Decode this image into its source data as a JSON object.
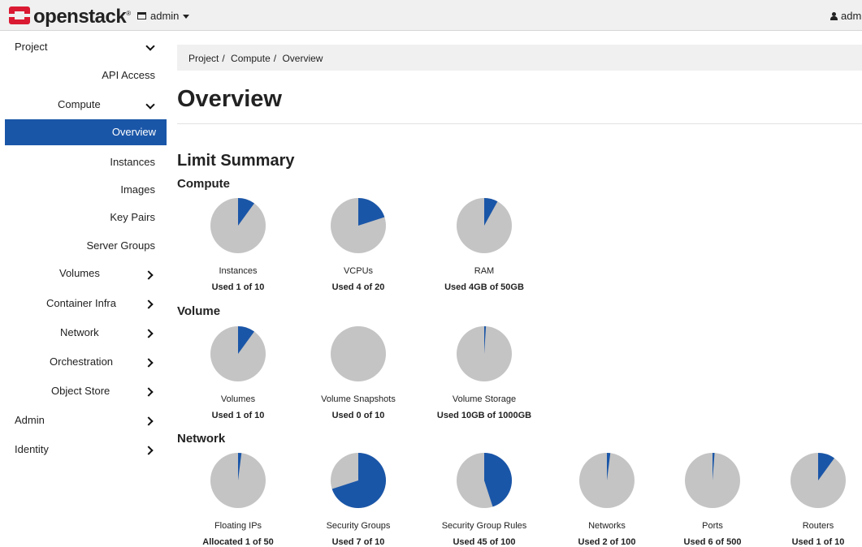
{
  "colors": {
    "accent": "#1a56a8",
    "pie_bg": "#c4c4c4",
    "brand_red": "#da1a32"
  },
  "header": {
    "brand": "openstack",
    "project_label": "admin",
    "user_label": "adm"
  },
  "sidebar": {
    "project": "Project",
    "api_access": "API Access",
    "compute": "Compute",
    "overview": "Overview",
    "instances": "Instances",
    "images": "Images",
    "key_pairs": "Key Pairs",
    "server_groups": "Server Groups",
    "volumes": "Volumes",
    "container_infra": "Container Infra",
    "network": "Network",
    "orchestration": "Orchestration",
    "object_store": "Object Store",
    "admin": "Admin",
    "identity": "Identity"
  },
  "breadcrumb": [
    "Project",
    "Compute",
    "Overview"
  ],
  "page": {
    "title": "Overview",
    "section": "Limit Summary"
  },
  "groups": [
    {
      "name": "Compute",
      "pies": [
        {
          "label": "Instances",
          "used_text": "Used 1 of 10",
          "used": 1,
          "total": 10
        },
        {
          "label": "VCPUs",
          "used_text": "Used 4 of 20",
          "used": 4,
          "total": 20
        },
        {
          "label": "RAM",
          "used_text": "Used 4GB of 50GB",
          "used": 4,
          "total": 50
        }
      ]
    },
    {
      "name": "Volume",
      "pies": [
        {
          "label": "Volumes",
          "used_text": "Used 1 of 10",
          "used": 1,
          "total": 10
        },
        {
          "label": "Volume Snapshots",
          "used_text": "Used 0 of 10",
          "used": 0,
          "total": 10
        },
        {
          "label": "Volume Storage",
          "used_text": "Used 10GB of 1000GB",
          "used": 10,
          "total": 1000
        }
      ]
    },
    {
      "name": "Network",
      "pies": [
        {
          "label": "Floating IPs",
          "used_text": "Allocated 1 of 50",
          "used": 1,
          "total": 50
        },
        {
          "label": "Security Groups",
          "used_text": "Used 7 of 10",
          "used": 7,
          "total": 10
        },
        {
          "label": "Security Group Rules",
          "used_text": "Used 45 of 100",
          "used": 45,
          "total": 100
        },
        {
          "label": "Networks",
          "used_text": "Used 2 of 100",
          "used": 2,
          "total": 100
        },
        {
          "label": "Ports",
          "used_text": "Used 6 of 500",
          "used": 6,
          "total": 500
        },
        {
          "label": "Routers",
          "used_text": "Used 1 of 10",
          "used": 1,
          "total": 10
        }
      ]
    }
  ]
}
